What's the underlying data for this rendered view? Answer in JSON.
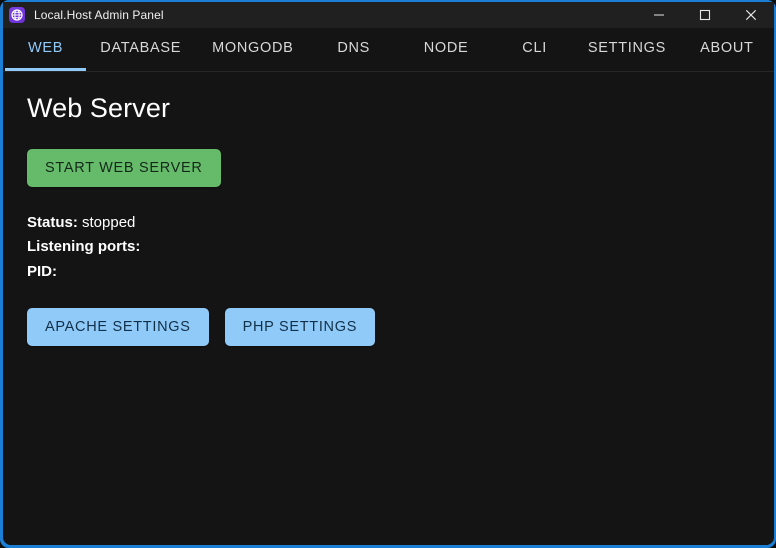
{
  "window": {
    "title": "Local.Host Admin Panel",
    "app_icon": "globe-icon",
    "accent_color": "#1c7fd6",
    "titlebar_bg": "#202020",
    "body_bg": "#141414",
    "controls": {
      "minimize": "minimize-icon",
      "maximize": "maximize-icon",
      "close": "close-icon"
    }
  },
  "tabs": {
    "active": "WEB",
    "active_color": "#90caf9",
    "inactive_color": "#d8d8d8",
    "items": [
      {
        "label": "WEB"
      },
      {
        "label": "DATABASE"
      },
      {
        "label": "MONGODB"
      },
      {
        "label": "DNS"
      },
      {
        "label": "NODE"
      },
      {
        "label": "CLI"
      },
      {
        "label": "SETTINGS"
      },
      {
        "label": "ABOUT"
      }
    ]
  },
  "main": {
    "heading": "Web Server",
    "start_button": {
      "label": "START WEB SERVER",
      "bg_color": "#66bb6a",
      "text_color": "#14281a"
    },
    "status": {
      "status_label": "Status:",
      "status_value": " stopped",
      "ports_label": "Listening ports:",
      "ports_value": "",
      "pid_label": "PID:",
      "pid_value": ""
    },
    "actions": [
      {
        "label": "APACHE SETTINGS",
        "bg_color": "#90caf9",
        "text_color": "#123047"
      },
      {
        "label": "PHP SETTINGS",
        "bg_color": "#90caf9",
        "text_color": "#123047"
      }
    ]
  }
}
